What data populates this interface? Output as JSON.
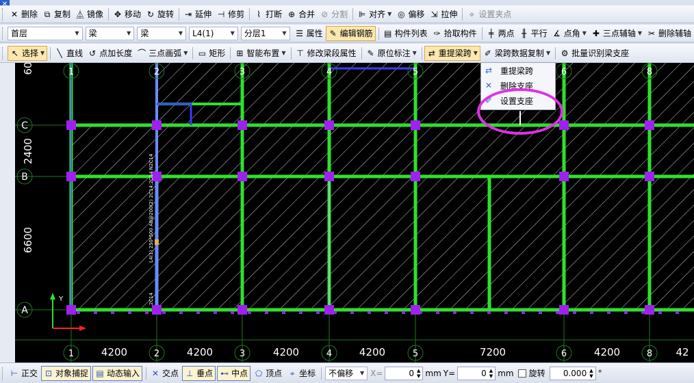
{
  "toolbar1": [
    {
      "label": "删除",
      "icon": "delete-icon",
      "glyph": "✕"
    },
    {
      "label": "复制",
      "icon": "copy-icon",
      "glyph": "⧉"
    },
    {
      "label": "镜像",
      "icon": "mirror-icon",
      "glyph": "⏅"
    },
    {
      "label": "移动",
      "icon": "move-icon",
      "glyph": "✥"
    },
    {
      "label": "旋转",
      "icon": "rotate-icon",
      "glyph": "↻"
    },
    {
      "label": "延伸",
      "icon": "extend-icon",
      "glyph": "⇥"
    },
    {
      "label": "修剪",
      "icon": "trim-icon",
      "glyph": "⊣"
    },
    {
      "label": "打断",
      "icon": "break-icon",
      "glyph": "⌇"
    },
    {
      "label": "合并",
      "icon": "merge-icon",
      "glyph": "⊕"
    },
    {
      "label": "分割",
      "icon": "split-icon",
      "glyph": "⊘",
      "disabled": true
    },
    {
      "label": "对齐",
      "icon": "align-icon",
      "glyph": "⊫",
      "dropdown": true
    },
    {
      "label": "偏移",
      "icon": "offset-icon",
      "glyph": "◎"
    },
    {
      "label": "拉伸",
      "icon": "stretch-icon",
      "glyph": "⇲"
    },
    {
      "label": "设置夹点",
      "icon": "grip-point-icon",
      "glyph": "⋄",
      "disabled": true
    }
  ],
  "toolbar2": {
    "floor": "首层",
    "category": "梁",
    "type": "梁",
    "member": "L4(1)",
    "layer": "分层1",
    "buttons": [
      {
        "label": "属性",
        "icon": "properties-icon",
        "glyph": "☰"
      },
      {
        "label": "编辑钢筋",
        "icon": "edit-rebar-icon",
        "glyph": "✎",
        "active": true
      },
      {
        "label": "构件列表",
        "icon": "component-list-icon",
        "glyph": "▤"
      },
      {
        "label": "拾取构件",
        "icon": "pick-component-icon",
        "glyph": "✑"
      },
      {
        "label": "两点",
        "icon": "two-point-icon",
        "glyph": "╪"
      },
      {
        "label": "平行",
        "icon": "parallel-icon",
        "glyph": "╫"
      },
      {
        "label": "点角",
        "icon": "point-angle-icon",
        "glyph": "∡",
        "dropdown": true
      },
      {
        "label": "三点辅轴",
        "icon": "three-point-axis-icon",
        "glyph": "✚",
        "dropdown": true
      },
      {
        "label": "删除辅轴",
        "icon": "delete-axis-icon",
        "glyph": "✂"
      }
    ]
  },
  "toolbar3": [
    {
      "label": "选择",
      "icon": "select-icon",
      "glyph": "↖",
      "active": true,
      "dropdown": true
    },
    {
      "label": "直线",
      "icon": "line-icon",
      "glyph": "╲"
    },
    {
      "label": "点加长度",
      "icon": "point-length-icon",
      "glyph": "↺"
    },
    {
      "label": "三点画弧",
      "icon": "arc-icon",
      "glyph": "⌒",
      "dropdown": true
    },
    {
      "label": "矩形",
      "icon": "rectangle-icon",
      "glyph": "▭"
    },
    {
      "label": "智能布置",
      "icon": "smart-layout-icon",
      "glyph": "⊞",
      "dropdown": true
    },
    {
      "label": "修改梁段属性",
      "icon": "modify-beam-icon",
      "glyph": "⊤"
    },
    {
      "label": "原位标注",
      "icon": "in-place-annotation-icon",
      "glyph": "✎",
      "dropdown": true
    },
    {
      "label": "重提梁跨",
      "icon": "re-extract-span-icon",
      "glyph": "⇄",
      "active": true,
      "dropdown": true
    },
    {
      "label": "梁跨数据复制",
      "icon": "span-data-copy-icon",
      "glyph": "✐",
      "dropdown": true
    },
    {
      "label": "批量识别梁支座",
      "icon": "batch-support-icon",
      "glyph": "⚙"
    }
  ],
  "dropdown_menu": [
    {
      "label": "重提梁跨",
      "icon": "re-extract-span-icon",
      "glyph": "⇄"
    },
    {
      "label": "删除支座",
      "icon": "delete-support-icon",
      "glyph": "✕"
    },
    {
      "label": "设置支座",
      "icon": "set-support-icon",
      "glyph": "✐"
    }
  ],
  "drawing": {
    "top_axes": [
      "1",
      "2",
      "3",
      "4",
      "5",
      "6",
      "8"
    ],
    "bottom_axes": [
      "1",
      "2",
      "3",
      "4",
      "5",
      "6",
      "8"
    ],
    "bottom_dims": [
      "4200",
      "4200",
      "4200",
      "4200",
      "7200",
      "4200",
      "42"
    ],
    "left_axes": [
      "C",
      "B",
      "A"
    ],
    "left_dims": [
      "60",
      "2400",
      "6600"
    ],
    "beam_annotation": "L4(1) 250*500 A8@200(2) 2C14;2C14 N2C14",
    "beam_small_label": "2C14",
    "ucs_y": "Y",
    "colors": {
      "beam": "#2ee02e",
      "grid": "#1f7a1f",
      "column": "#a020f0",
      "selected": "#6a8cff",
      "hatch": "#cfcfcf",
      "highlight": "#e12fe6"
    }
  },
  "statusbar": {
    "buttons": [
      {
        "label": "正交",
        "icon": "ortho-icon",
        "glyph": "⊢",
        "on": false
      },
      {
        "label": "对象捕捉",
        "icon": "object-snap-icon",
        "glyph": "⊡",
        "on": true
      },
      {
        "label": "动态输入",
        "icon": "dynamic-input-icon",
        "glyph": "▤",
        "on": true
      },
      {
        "label": "交点",
        "icon": "intersection-icon",
        "glyph": "✕",
        "on": false
      },
      {
        "label": "垂点",
        "icon": "perpendicular-icon",
        "glyph": "⊥",
        "on": true
      },
      {
        "label": "中点",
        "icon": "midpoint-icon",
        "glyph": "⊷",
        "on": true
      },
      {
        "label": "顶点",
        "icon": "vertex-icon",
        "glyph": "⬠",
        "on": false
      },
      {
        "label": "坐标",
        "icon": "coordinate-icon",
        "glyph": "⌖",
        "on": false
      }
    ],
    "offset_mode": "不偏移",
    "x_label": "X=",
    "x_value": "0",
    "x_unit": "mm",
    "y_label": "Y=",
    "y_value": "0",
    "y_unit": "mm",
    "rotate_label": "旋转",
    "rotate_value": "0.000",
    "degree": "°"
  }
}
